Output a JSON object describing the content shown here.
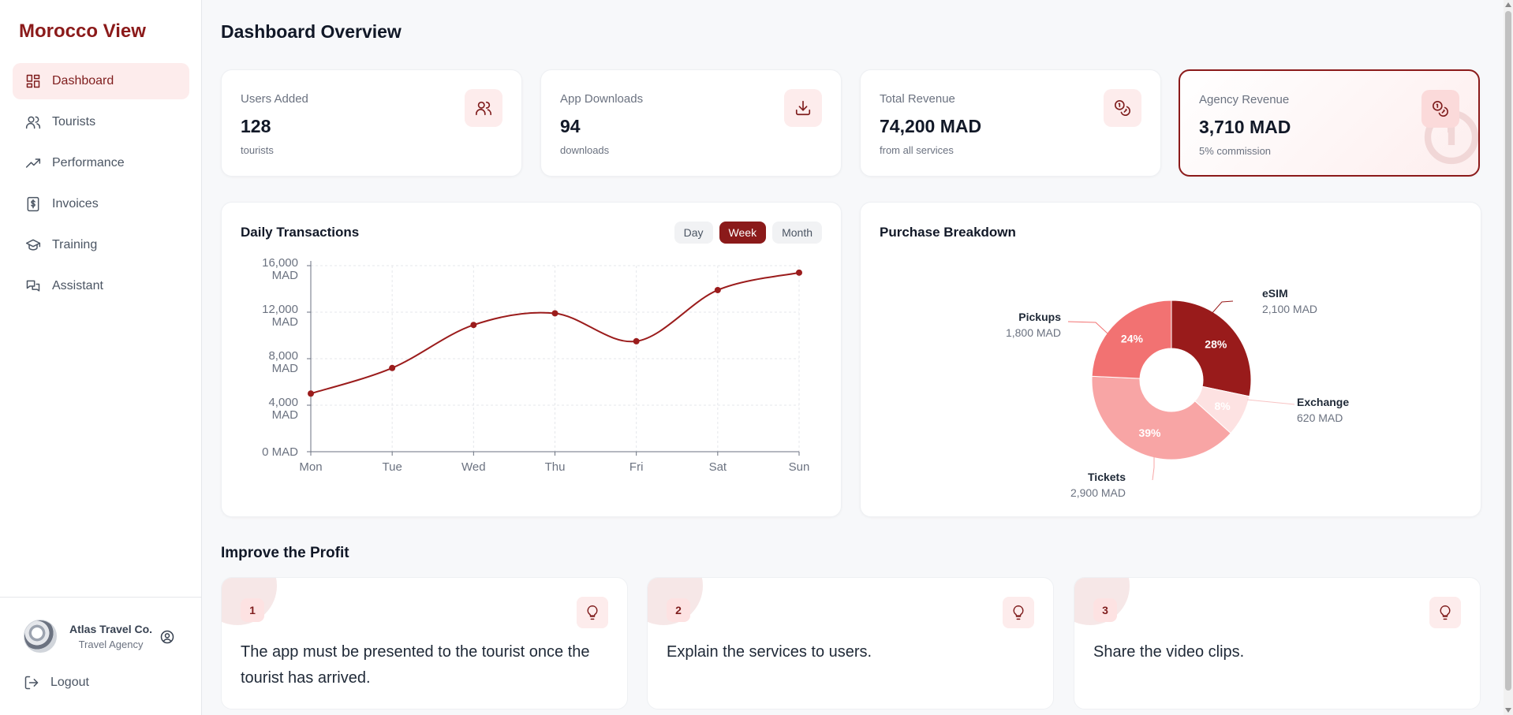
{
  "brand": "Morocco View",
  "sidebar": {
    "items": [
      {
        "label": "Dashboard",
        "icon": "dashboard-icon",
        "active": true
      },
      {
        "label": "Tourists",
        "icon": "users-icon"
      },
      {
        "label": "Performance",
        "icon": "trend-up-icon"
      },
      {
        "label": "Invoices",
        "icon": "invoice-icon"
      },
      {
        "label": "Training",
        "icon": "graduation-cap-icon"
      },
      {
        "label": "Assistant",
        "icon": "chat-icon"
      }
    ],
    "profile": {
      "name": "Atlas Travel Co.",
      "role": "Travel Agency"
    },
    "logout": "Logout"
  },
  "page_title": "Dashboard Overview",
  "stats": [
    {
      "label": "Users Added",
      "value": "128",
      "sub": "tourists",
      "icon": "users-icon"
    },
    {
      "label": "App Downloads",
      "value": "94",
      "sub": "downloads",
      "icon": "download-icon"
    },
    {
      "label": "Total Revenue",
      "value": "74,200 MAD",
      "sub": "from all services",
      "icon": "coins-icon"
    },
    {
      "label": "Agency Revenue",
      "value": "3,710 MAD",
      "sub": "5% commission",
      "icon": "coins-icon"
    }
  ],
  "transactions": {
    "title": "Daily Transactions",
    "ranges": [
      "Day",
      "Week",
      "Month"
    ],
    "active_range": "Week"
  },
  "breakdown": {
    "title": "Purchase Breakdown"
  },
  "chart_data": [
    {
      "type": "line",
      "categories": [
        "Mon",
        "Tue",
        "Wed",
        "Thu",
        "Fri",
        "Sat",
        "Sun"
      ],
      "values": [
        5000,
        7200,
        10900,
        11900,
        9500,
        13900,
        15400
      ],
      "ylim": [
        0,
        16000
      ],
      "yticks": [
        "0 MAD",
        "4,000 MAD",
        "8,000 MAD",
        "12,000 MAD",
        "16,000 MAD"
      ],
      "ytick_values": [
        0,
        4000,
        8000,
        12000,
        16000
      ],
      "color": "#9b1c1c",
      "grid": true
    },
    {
      "type": "pie",
      "slices": [
        {
          "label": "eSIM",
          "amount": "2,100 MAD",
          "value": 2100,
          "percent": "28%",
          "color": "#991b1b"
        },
        {
          "label": "Exchange",
          "amount": "620 MAD",
          "value": 620,
          "percent": "8%",
          "color": "#fde2e2"
        },
        {
          "label": "Tickets",
          "amount": "2,900 MAD",
          "value": 2900,
          "percent": "39%",
          "color": "#f8a5a5"
        },
        {
          "label": "Pickups",
          "amount": "1,800 MAD",
          "value": 1800,
          "percent": "24%",
          "color": "#f27272"
        }
      ]
    }
  ],
  "improve": {
    "title": "Improve the Profit",
    "tips": [
      {
        "num": "1",
        "text": "The app must be presented to the tourist once the tourist has arrived."
      },
      {
        "num": "2",
        "text": "Explain the services to users."
      },
      {
        "num": "3",
        "text": "Share the video clips."
      }
    ]
  }
}
